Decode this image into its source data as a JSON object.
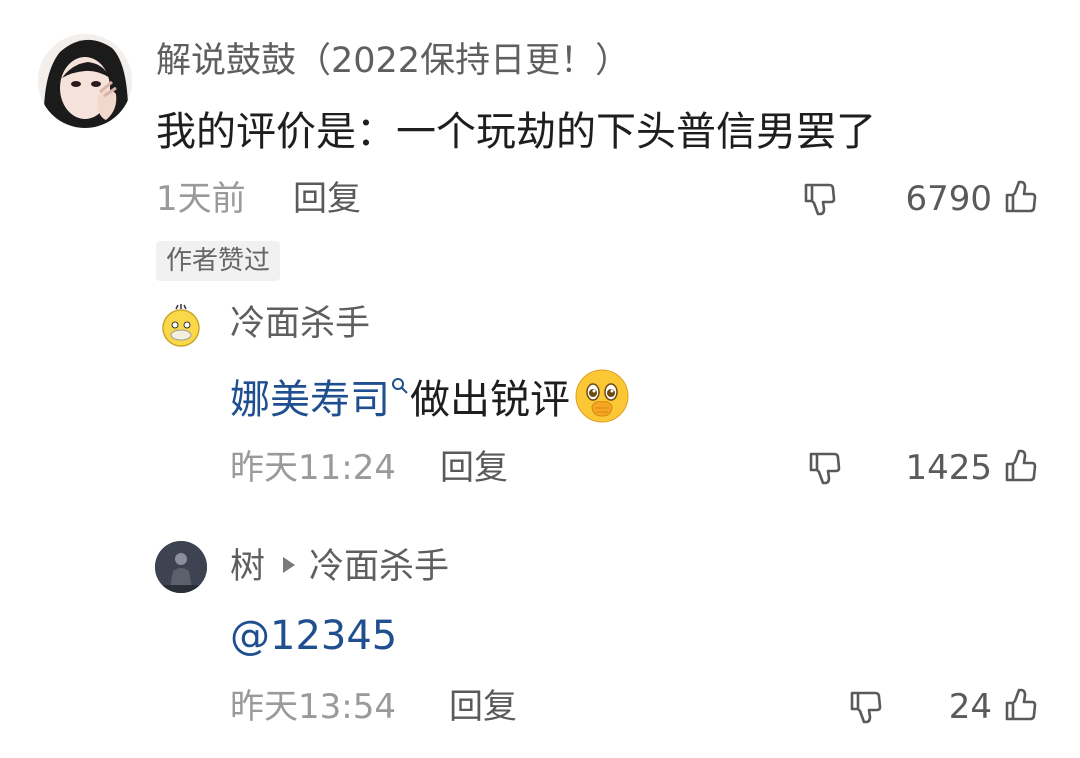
{
  "comment": {
    "username": "解说鼓鼓（2022保持日更！）",
    "text": "我的评价是：一个玩劫的下头普信男罢了",
    "time": "1天前",
    "reply_label": "回复",
    "like_count": "6790",
    "author_liked_badge": "作者赞过"
  },
  "replies": [
    {
      "username": "冷面杀手",
      "text_link": "娜美寿司",
      "text_rest": "做出锐评",
      "time": "昨天11:24",
      "reply_label": "回复",
      "like_count": "1425"
    },
    {
      "username": "树",
      "reply_to": "冷面杀手",
      "text_link": "@12345",
      "time": "昨天13:54",
      "reply_label": "回复",
      "like_count": "24"
    }
  ],
  "icons": {
    "like": "thumbs-up-icon",
    "dislike": "thumbs-down-icon",
    "search": "search-icon",
    "emoji": "holding-back-tears-emoji"
  },
  "colors": {
    "link": "#1f4f8f",
    "meta": "#9a9a9a",
    "text": "#1e1e1e"
  }
}
